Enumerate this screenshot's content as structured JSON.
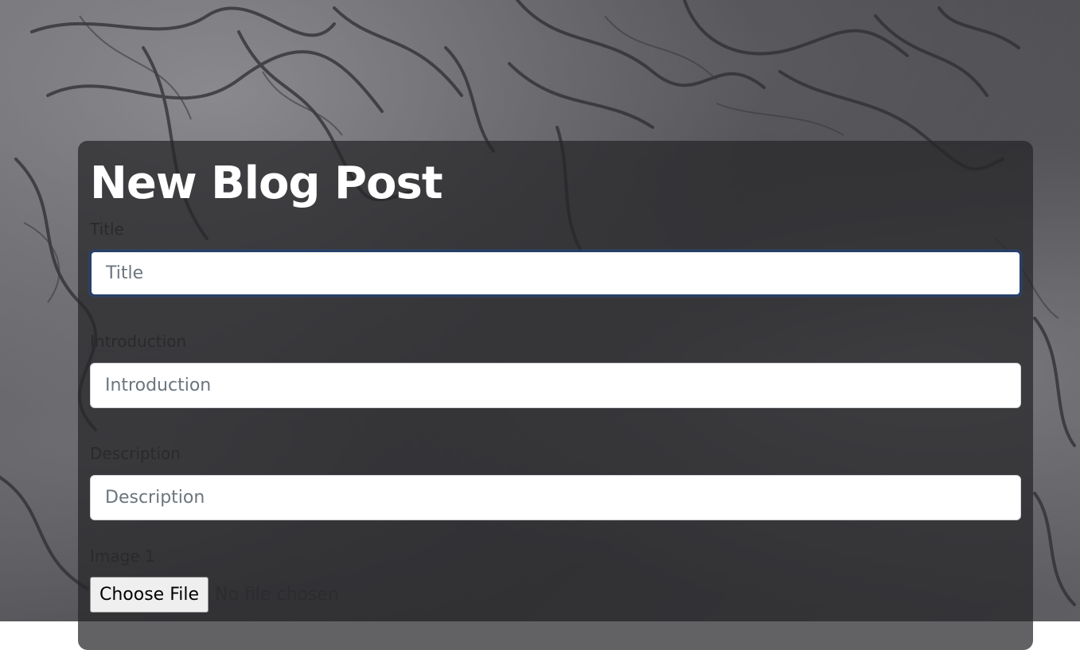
{
  "page": {
    "title": "New Blog Post"
  },
  "form": {
    "title_field": {
      "label": "Title",
      "placeholder": "Title",
      "value": ""
    },
    "introduction_field": {
      "label": "Introduction",
      "placeholder": "Introduction",
      "value": ""
    },
    "description_field": {
      "label": "Description",
      "placeholder": "Description",
      "value": ""
    },
    "image1_field": {
      "label": "Image 1",
      "button_label": "Choose File",
      "status": "No file chosen"
    }
  },
  "colors": {
    "card_background": "#262628",
    "focus_border": "#253f6b",
    "title_text": "#ffffff"
  }
}
